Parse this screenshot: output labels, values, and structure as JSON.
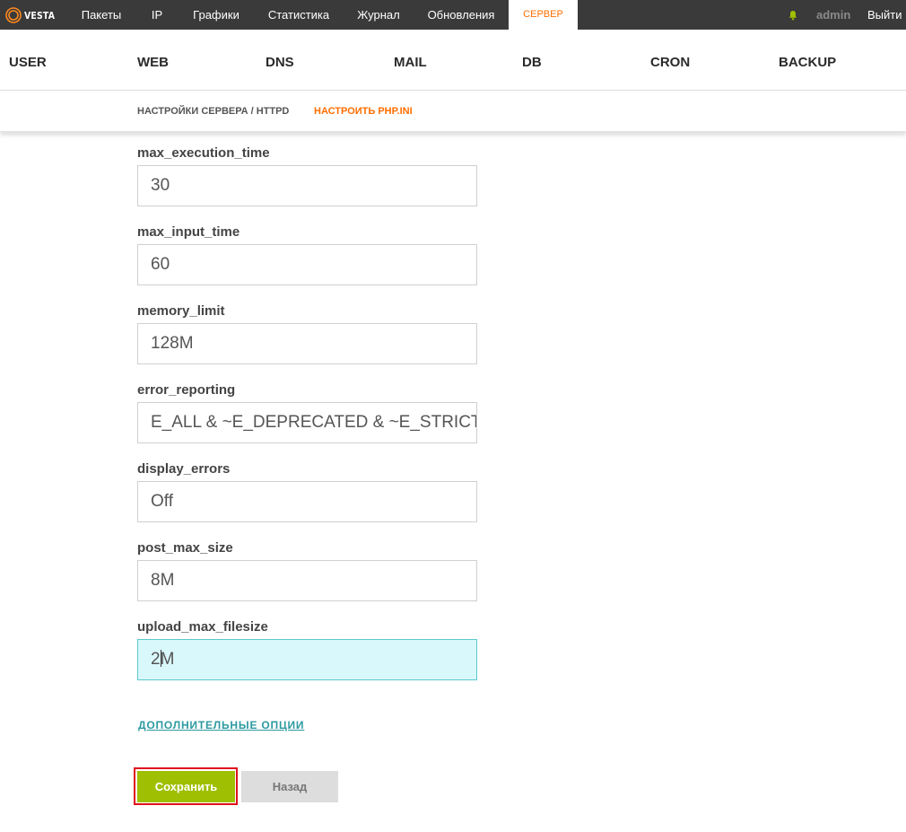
{
  "topbar": {
    "logo": "VESTA",
    "nav": [
      "Пакеты",
      "IP",
      "Графики",
      "Статистика",
      "Журнал",
      "Обновления",
      "СЕРВЕР"
    ],
    "active_nav": "СЕРВЕР",
    "user": "admin",
    "logout": "Выйти",
    "colors": {
      "background": "#3a3a3a",
      "active": "#ff6e00",
      "bell": "#9fbf02"
    }
  },
  "sections": [
    "USER",
    "WEB",
    "DNS",
    "MAIL",
    "DB",
    "CRON",
    "BACKUP"
  ],
  "subtabs": {
    "server_settings": "НАСТРОЙКИ СЕРВЕРА / HTTPD",
    "configure_php": "НАСТРОИТЬ PHP.INI"
  },
  "fields": [
    {
      "label": "max_execution_time",
      "value": "30"
    },
    {
      "label": "max_input_time",
      "value": "60"
    },
    {
      "label": "memory_limit",
      "value": "128M"
    },
    {
      "label": "error_reporting",
      "value": "E_ALL & ~E_DEPRECATED & ~E_STRICT"
    },
    {
      "label": "display_errors",
      "value": "Off"
    },
    {
      "label": "post_max_size",
      "value": "8M"
    },
    {
      "label": "upload_max_filesize",
      "value_before_caret": "2",
      "value_after_caret": "M"
    }
  ],
  "advanced_link": "ДОПОЛНИТЕЛЬНЫЕ ОПЦИИ",
  "buttons": {
    "save": "Сохранить",
    "back": "Назад"
  },
  "icons": {
    "logo": "vesta-logo-icon",
    "bell": "bell-icon"
  }
}
